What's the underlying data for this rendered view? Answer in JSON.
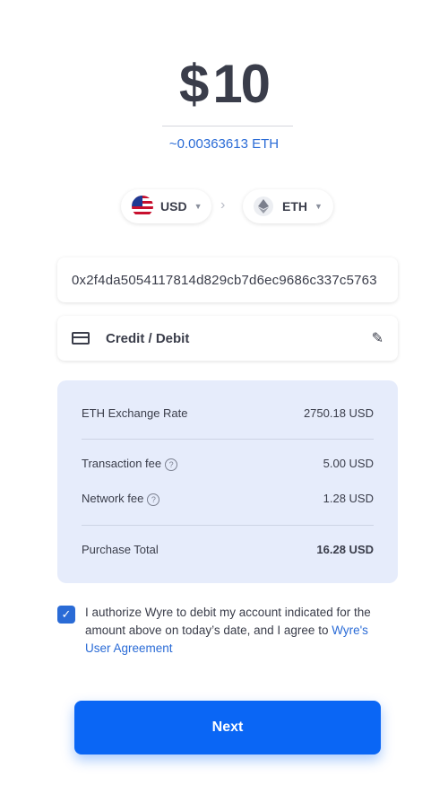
{
  "amount": {
    "currency_symbol": "$",
    "value": "10"
  },
  "eth_estimate": "~0.00363613 ETH",
  "currency_from": {
    "code": "USD",
    "icon": "us-flag-icon"
  },
  "currency_to": {
    "code": "ETH",
    "icon": "ethereum-icon"
  },
  "wallet_address": "0x2f4da5054117814d829cb7d6ec9686c337c5763",
  "payment_method": {
    "label": "Credit / Debit",
    "icon": "credit-card-icon",
    "edit_icon": "pencil-icon"
  },
  "summary": {
    "exchange_rate_label": "ETH Exchange Rate",
    "exchange_rate_value": "2750.18 USD",
    "transaction_fee_label": "Transaction fee",
    "transaction_fee_value": "5.00 USD",
    "network_fee_label": "Network fee",
    "network_fee_value": "1.28 USD",
    "total_label": "Purchase Total",
    "total_value": "16.28 USD"
  },
  "consent": {
    "text": "I authorize Wyre to debit my account indicated for the amount above on today’s date, and I agree to ",
    "link": "Wyre's User Agreement",
    "checked": true
  },
  "next_label": "Next",
  "colors": {
    "accent": "#0a66f5",
    "link": "#2a6bd6",
    "summary_bg": "#e6ecfb"
  }
}
